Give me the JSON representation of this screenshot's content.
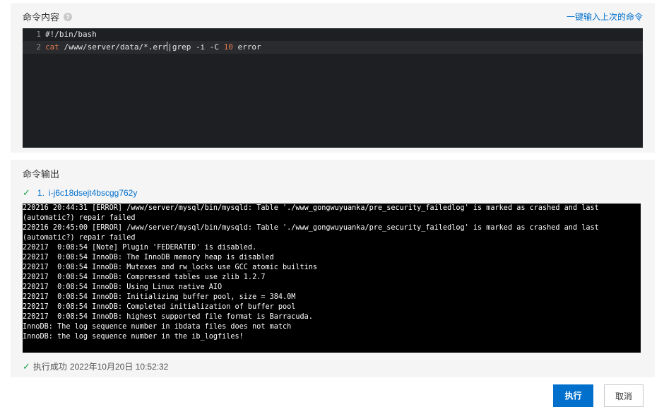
{
  "command_panel": {
    "title": "命令内容",
    "help_icon": "question-circle-icon",
    "recent_link": "一键输入上次的命令",
    "code_lines": [
      {
        "num": "1",
        "shebang": "#!/bin/bash"
      },
      {
        "num": "2",
        "cmd": "cat",
        "arg1": " /www/server/data/*.err",
        "pipe": "|grep -i -C ",
        "num_arg": "10",
        "arg2": " error"
      }
    ]
  },
  "output_panel": {
    "title": "命令输出",
    "instance": {
      "status_icon": "check-icon",
      "index": "1.",
      "id": "i-j6c18dsejt4bscgg762y"
    },
    "log_lines": [
      "220216 20:44:31 [ERROR] /www/server/mysql/bin/mysqld: Table './www_gongwuyuanka/pre_security_failedlog' is marked as crashed and last (automatic?) repair failed",
      "220216 20:45:00 [ERROR] /www/server/mysql/bin/mysqld: Table './www_gongwuyuanka/pre_security_failedlog' is marked as crashed and last (automatic?) repair failed",
      "220217  0:08:54 [Note] Plugin 'FEDERATED' is disabled.",
      "220217  0:08:54 InnoDB: The InnoDB memory heap is disabled",
      "220217  0:08:54 InnoDB: Mutexes and rw_locks use GCC atomic builtins",
      "220217  0:08:54 InnoDB: Compressed tables use zlib 1.2.7",
      "220217  0:08:54 InnoDB: Using Linux native AIO",
      "220217  0:08:54 InnoDB: Initializing buffer pool, size = 384.0M",
      "220217  0:08:54 InnoDB: Completed initialization of buffer pool",
      "220217  0:08:54 InnoDB: highest supported file format is Barracuda.",
      "InnoDB: The log sequence number in ibdata files does not match",
      "InnoDB: the log sequence number in the ib_logfiles!"
    ],
    "status": {
      "icon": "check-icon",
      "text": "执行成功",
      "time": "2022年10月20日 10:52:32"
    }
  },
  "footer": {
    "execute_label": "执行",
    "cancel_label": "取消"
  },
  "colors": {
    "accent": "#0070cc",
    "success": "#1aa34a",
    "editor_bg": "#1e1f22",
    "terminal_bg": "#000000"
  }
}
